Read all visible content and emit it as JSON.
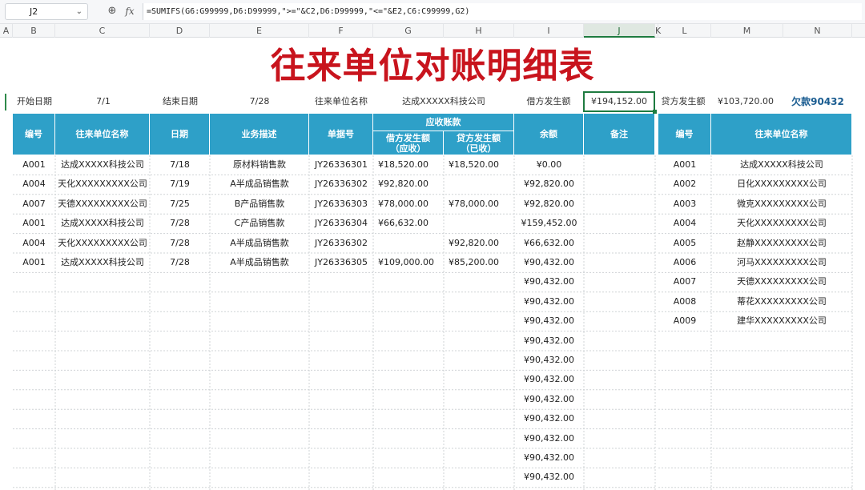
{
  "formula_bar": {
    "cell_ref": "J2",
    "formula": "=SUMIFS(G6:G99999,D6:D99999,\">=\"&C2,D6:D99999,\"<=\"&E2,C6:C99999,G2)"
  },
  "columns": [
    "A",
    "B",
    "C",
    "D",
    "E",
    "F",
    "G",
    "H",
    "I",
    "J",
    "K",
    "L",
    "M",
    "N"
  ],
  "selected_column": "J",
  "sheet_title": "往来单位对账明细表",
  "info": {
    "start_label": "开始日期",
    "start_value": "7/1",
    "end_label": "结束日期",
    "end_value": "7/28",
    "partner_label": "往来单位名称",
    "partner_value": "达成XXXXX科技公司",
    "debit_label": "借方发生额",
    "debit_value": "¥194,152.00",
    "credit_label": "贷方发生额",
    "credit_value": "¥103,720.00",
    "owed": "欠款90432"
  },
  "main_table": {
    "headers": {
      "code": "编号",
      "partner": "往来单位名称",
      "date": "日期",
      "desc": "业务描述",
      "doc": "单据号",
      "receivable": "应收账款",
      "debit": "借方发生额\n（应收）",
      "credit": "贷方发生额\n（已收）",
      "balance": "余额",
      "note": "备注"
    },
    "rows": [
      {
        "code": "A001",
        "partner": "达成XXXXX科技公司",
        "date": "7/18",
        "desc": "原材料销售款",
        "doc": "JY26336301",
        "debit": "¥18,520.00",
        "credit": "¥18,520.00",
        "balance": "¥0.00"
      },
      {
        "code": "A004",
        "partner": "天化XXXXXXXXX公司",
        "date": "7/19",
        "desc": "A半成品销售款",
        "doc": "JY26336302",
        "debit": "¥92,820.00",
        "credit": "",
        "balance": "¥92,820.00"
      },
      {
        "code": "A007",
        "partner": "天德XXXXXXXXX公司",
        "date": "7/25",
        "desc": "B产品销售款",
        "doc": "JY26336303",
        "debit": "¥78,000.00",
        "credit": "¥78,000.00",
        "balance": "¥92,820.00"
      },
      {
        "code": "A001",
        "partner": "达成XXXXX科技公司",
        "date": "7/28",
        "desc": "C产品销售款",
        "doc": "JY26336304",
        "debit": "¥66,632.00",
        "credit": "",
        "balance": "¥159,452.00"
      },
      {
        "code": "A004",
        "partner": "天化XXXXXXXXX公司",
        "date": "7/28",
        "desc": "A半成品销售款",
        "doc": "JY26336302",
        "debit": "",
        "credit": "¥92,820.00",
        "balance": "¥66,632.00"
      },
      {
        "code": "A001",
        "partner": "达成XXXXX科技公司",
        "date": "7/28",
        "desc": "A半成品销售款",
        "doc": "JY26336305",
        "debit": "¥109,000.00",
        "credit": "¥85,200.00",
        "balance": "¥90,432.00"
      }
    ],
    "carry_balance": "¥90,432.00"
  },
  "side_table": {
    "headers": {
      "code": "编号",
      "partner": "往来单位名称"
    },
    "rows": [
      {
        "code": "A001",
        "partner": "达成XXXXX科技公司"
      },
      {
        "code": "A002",
        "partner": "日化XXXXXXXXX公司"
      },
      {
        "code": "A003",
        "partner": "微克XXXXXXXXX公司"
      },
      {
        "code": "A004",
        "partner": "天化XXXXXXXXX公司"
      },
      {
        "code": "A005",
        "partner": "赵静XXXXXXXXX公司"
      },
      {
        "code": "A006",
        "partner": "河马XXXXXXXXX公司"
      },
      {
        "code": "A007",
        "partner": "天德XXXXXXXXX公司"
      },
      {
        "code": "A008",
        "partner": "蒂花XXXXXXXXX公司"
      },
      {
        "code": "A009",
        "partner": "建华XXXXXXXXX公司"
      }
    ]
  },
  "colors": {
    "header_bg": "#2ea0c8",
    "title": "#c8141d",
    "accent": "#1e7b40",
    "owed": "#1b5d91"
  },
  "icons": {
    "zoom": "zoom-icon",
    "fx": "function-icon",
    "namebox": "chevron-down-icon"
  }
}
